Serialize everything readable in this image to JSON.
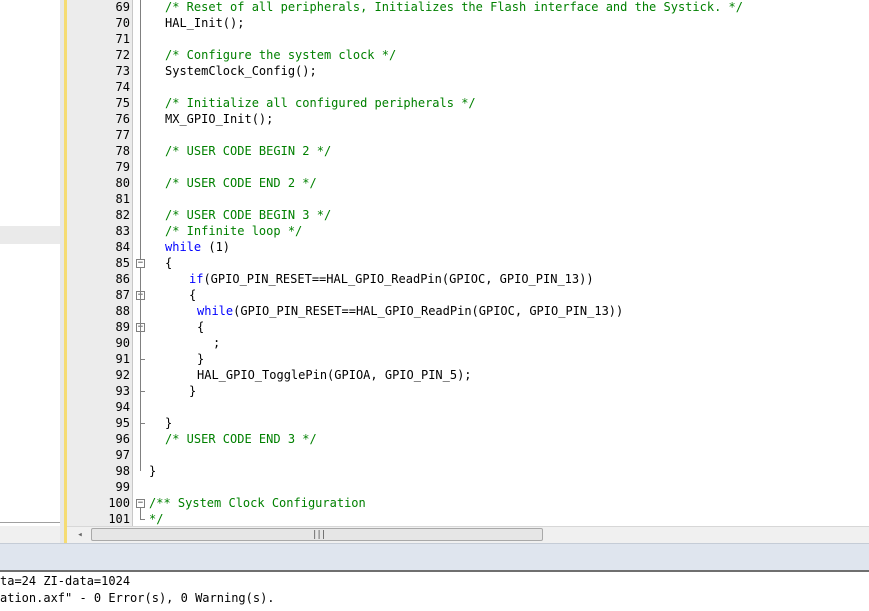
{
  "editor": {
    "line_numbers": [
      "69",
      "70",
      "71",
      "72",
      "73",
      "74",
      "75",
      "76",
      "77",
      "78",
      "79",
      "80",
      "81",
      "82",
      "83",
      "84",
      "85",
      "86",
      "87",
      "88",
      "89",
      "90",
      "91",
      "92",
      "93",
      "94",
      "95",
      "96",
      "97",
      "98",
      "99",
      "100",
      "101"
    ],
    "lines": [
      {
        "ln": "69",
        "parts": [
          {
            "t": "/* Reset of all peripherals, Initializes the Flash interface and the Systick. */",
            "c": "cm"
          }
        ]
      },
      {
        "ln": "70",
        "parts": [
          {
            "t": "HAL_Init();",
            "c": ""
          }
        ]
      },
      {
        "ln": "71",
        "parts": []
      },
      {
        "ln": "72",
        "parts": [
          {
            "t": "/* Configure the system clock */",
            "c": "cm"
          }
        ]
      },
      {
        "ln": "73",
        "parts": [
          {
            "t": "SystemClock_Config();",
            "c": ""
          }
        ]
      },
      {
        "ln": "74",
        "parts": []
      },
      {
        "ln": "75",
        "parts": [
          {
            "t": "/* Initialize all configured peripherals */",
            "c": "cm"
          }
        ]
      },
      {
        "ln": "76",
        "parts": [
          {
            "t": "MX_GPIO_Init();",
            "c": ""
          }
        ]
      },
      {
        "ln": "77",
        "parts": []
      },
      {
        "ln": "78",
        "parts": [
          {
            "t": "/* USER CODE BEGIN 2 */",
            "c": "cm"
          }
        ]
      },
      {
        "ln": "79",
        "parts": []
      },
      {
        "ln": "80",
        "parts": [
          {
            "t": "/* USER CODE END 2 */",
            "c": "cm"
          }
        ]
      },
      {
        "ln": "81",
        "parts": []
      },
      {
        "ln": "82",
        "parts": [
          {
            "t": "/* USER CODE BEGIN 3 */",
            "c": "cm"
          }
        ]
      },
      {
        "ln": "83",
        "parts": [
          {
            "t": "/* Infinite loop */",
            "c": "cm"
          }
        ]
      },
      {
        "ln": "84",
        "parts": [
          {
            "t": "while",
            "c": "kw"
          },
          {
            "t": " (1)",
            "c": ""
          }
        ]
      },
      {
        "ln": "85",
        "parts": [
          {
            "t": "{",
            "c": ""
          }
        ]
      },
      {
        "ln": "86",
        "parts": [
          {
            "t": "if",
            "c": "kw"
          },
          {
            "t": "(GPIO_PIN_RESET==HAL_GPIO_ReadPin(GPIOC, GPIO_PIN_13))",
            "c": ""
          }
        ]
      },
      {
        "ln": "87",
        "parts": [
          {
            "t": "{",
            "c": ""
          }
        ]
      },
      {
        "ln": "88",
        "parts": [
          {
            "t": "while",
            "c": "kw"
          },
          {
            "t": "(GPIO_PIN_RESET==HAL_GPIO_ReadPin(GPIOC, GPIO_PIN_13))",
            "c": ""
          }
        ]
      },
      {
        "ln": "89",
        "parts": [
          {
            "t": "{",
            "c": ""
          }
        ]
      },
      {
        "ln": "90",
        "parts": [
          {
            "t": ";",
            "c": ""
          }
        ]
      },
      {
        "ln": "91",
        "parts": [
          {
            "t": "}",
            "c": ""
          }
        ]
      },
      {
        "ln": "92",
        "parts": [
          {
            "t": "HAL_GPIO_TogglePin(GPIOA, GPIO_PIN_5);",
            "c": ""
          }
        ]
      },
      {
        "ln": "93",
        "parts": [
          {
            "t": "}",
            "c": ""
          }
        ]
      },
      {
        "ln": "94",
        "parts": []
      },
      {
        "ln": "95",
        "parts": [
          {
            "t": "}",
            "c": ""
          }
        ]
      },
      {
        "ln": "96",
        "parts": [
          {
            "t": "/* USER CODE END 3 */",
            "c": "cm"
          }
        ]
      },
      {
        "ln": "97",
        "parts": []
      },
      {
        "ln": "98",
        "parts": [
          {
            "t": "}",
            "c": ""
          }
        ]
      },
      {
        "ln": "99",
        "parts": []
      },
      {
        "ln": "100",
        "parts": [
          {
            "t": "/** System Clock Configuration",
            "c": "cm"
          }
        ]
      },
      {
        "ln": "101",
        "parts": [
          {
            "t": "*/",
            "c": "cm"
          }
        ]
      }
    ],
    "fold_markers": {
      "85": "−",
      "87": "−",
      "89": "−",
      "100": "−"
    }
  },
  "scrollbar": {
    "left_arrow_icon": "◂",
    "grip_glyph": "|||"
  },
  "build_output": {
    "line1": "ta=24 ZI-data=1024",
    "line2": "ation.axf\" - 0 Error(s), 0 Warning(s)."
  },
  "colors": {
    "comment": "#008000",
    "keyword": "#0000ff",
    "gutter": "#ececec",
    "splitter_accent": "#f5dc73"
  }
}
